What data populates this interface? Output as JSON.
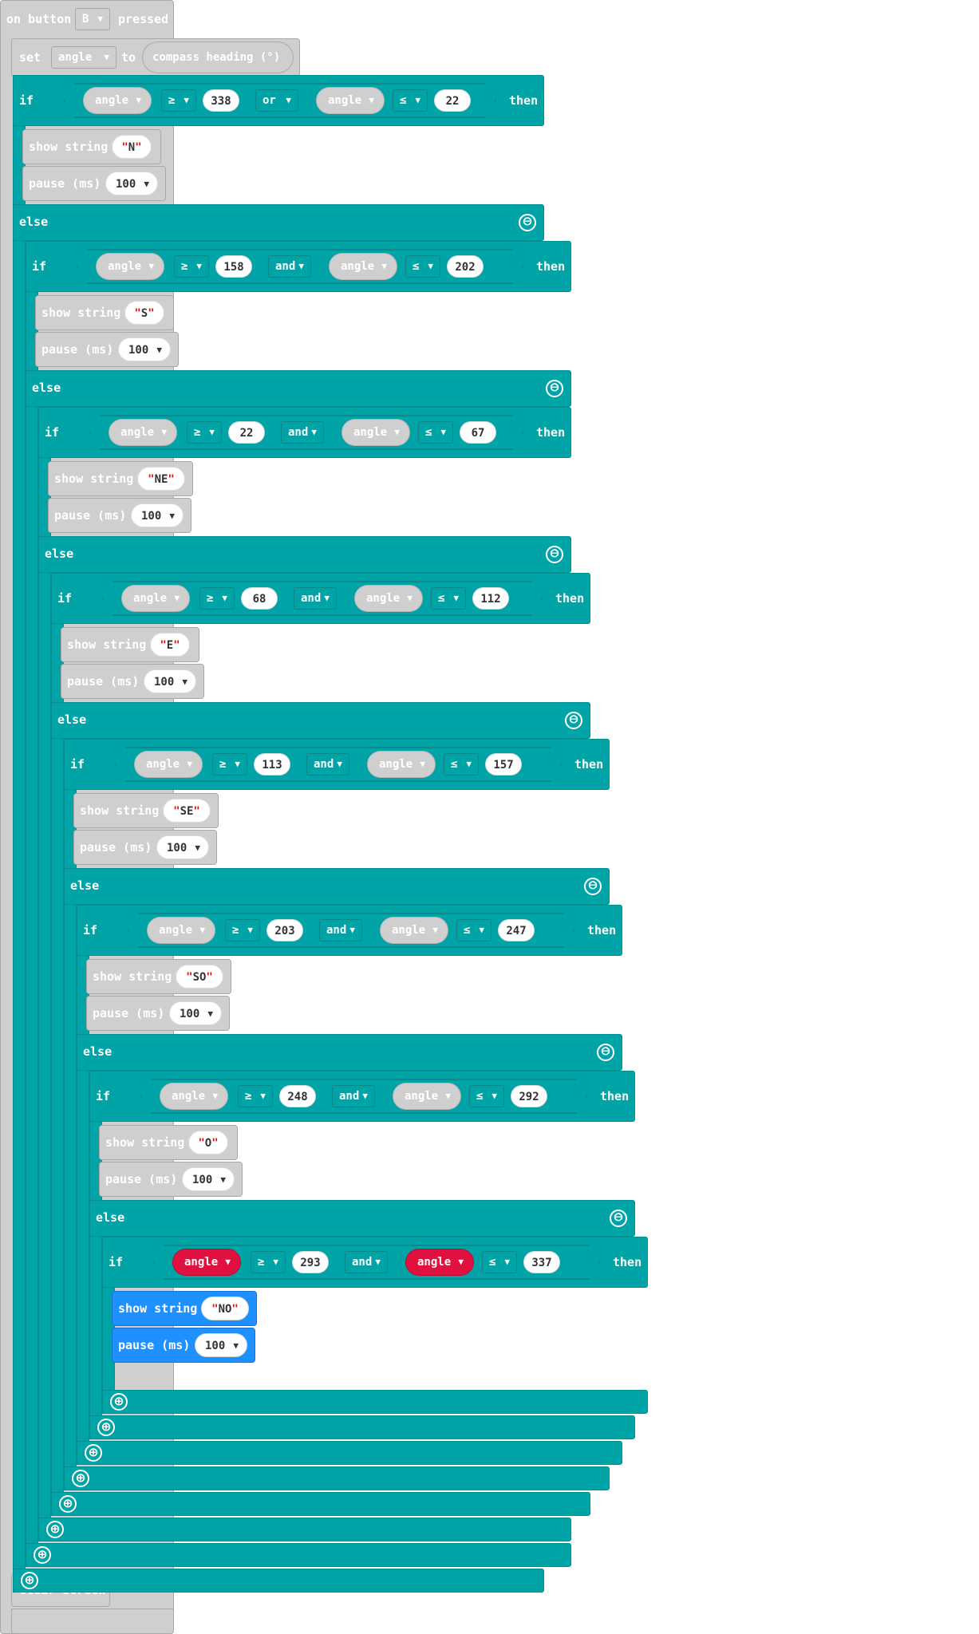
{
  "event": {
    "prefix": "on button",
    "button": "B",
    "suffix": "pressed"
  },
  "set_block": {
    "label": "set",
    "variable": "angle",
    "to": "to",
    "value": "compass heading (°)"
  },
  "common": {
    "if": "if",
    "then": "then",
    "else": "else",
    "var": "angle",
    "show_string": "show string",
    "pause": "pause (ms)",
    "pause_value": "100",
    "ge": "≥",
    "le": "≤",
    "minus_icon": "⊖",
    "plus_icon": "⊕",
    "caret": "▼",
    "quote": "\""
  },
  "conditions": [
    {
      "op": "or",
      "low": "338",
      "high": "22",
      "text": "N"
    },
    {
      "op": "and",
      "low": "158",
      "high": "202",
      "text": "S"
    },
    {
      "op": "and",
      "low": "22",
      "high": "67",
      "text": "NE"
    },
    {
      "op": "and",
      "low": "68",
      "high": "112",
      "text": "E"
    },
    {
      "op": "and",
      "low": "113",
      "high": "157",
      "text": "SE"
    },
    {
      "op": "and",
      "low": "203",
      "high": "247",
      "text": "SO"
    },
    {
      "op": "and",
      "low": "248",
      "high": "292",
      "text": "O"
    },
    {
      "op": "and",
      "low": "293",
      "high": "337",
      "text": "NO"
    }
  ],
  "final": {
    "label": "clear screen"
  },
  "colors": {
    "logic": "#00a4a6",
    "gray": "#cfcfcf",
    "basic": "#1e90ff",
    "highlight": "#e0103f"
  }
}
